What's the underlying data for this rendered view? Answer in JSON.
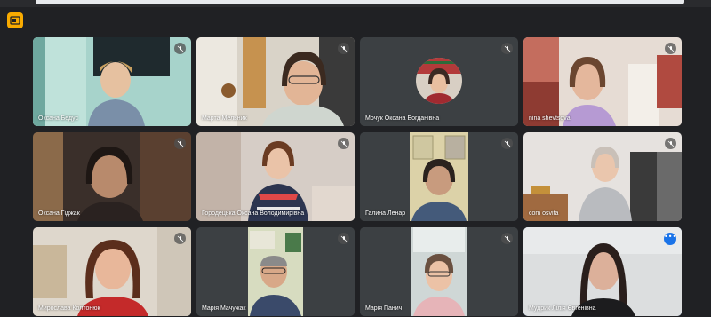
{
  "app": {
    "info_icon": "meeting-info-icon",
    "accent_color": "#f9ab00",
    "active_border_color": "#8ab4f8"
  },
  "participants": [
    {
      "name": "Оксана Бедус",
      "muted": true
    },
    {
      "name": "Марта Мельник",
      "muted": true
    },
    {
      "name": "Мочук Оксана Богданівна",
      "muted": true,
      "avatar": true
    },
    {
      "name": "nina shevtsova",
      "muted": true
    },
    {
      "name": "Оксана Гіджак",
      "muted": true
    },
    {
      "name": "Городецька Оксана Володимирівна",
      "muted": true
    },
    {
      "name": "Галина Ленар",
      "muted": true
    },
    {
      "name": "com osvita",
      "muted": true
    },
    {
      "name": "Мирослава Колтонюк",
      "muted": true
    },
    {
      "name": "Марія Мачужак",
      "muted": true
    },
    {
      "name": "Марія Панич",
      "muted": true
    },
    {
      "name": "Мудрик Лілія Євгенівна",
      "muted": false,
      "active": true,
      "more_options": "•••"
    }
  ]
}
